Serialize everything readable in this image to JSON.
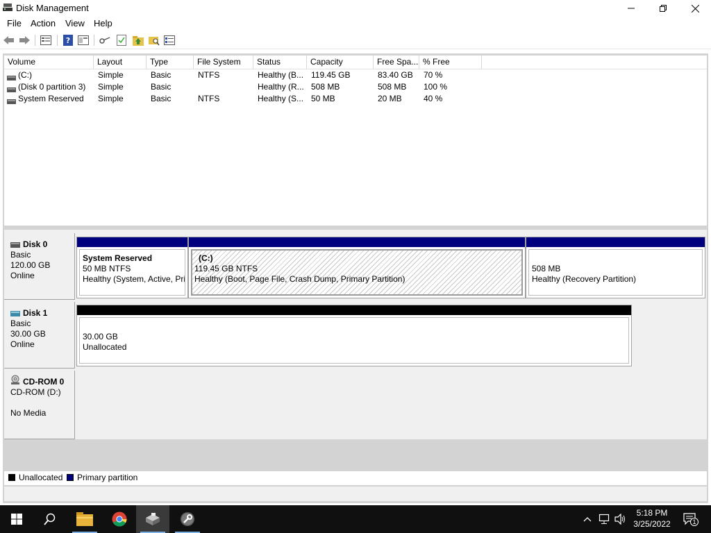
{
  "window": {
    "title": "Disk Management"
  },
  "menu": [
    "File",
    "Action",
    "View",
    "Help"
  ],
  "toolbar_icons": [
    "back-arrow-icon",
    "forward-arrow-icon",
    "list-view-icon",
    "help-icon",
    "properties-icon",
    "key-icon",
    "check-icon",
    "folder-up-icon",
    "search-folder-icon",
    "settings-list-icon"
  ],
  "volume_table": {
    "columns": [
      "Volume",
      "Layout",
      "Type",
      "File System",
      "Status",
      "Capacity",
      "Free Spa...",
      "% Free"
    ],
    "rows": [
      {
        "volume": "(C:)",
        "layout": "Simple",
        "type": "Basic",
        "fs": "NTFS",
        "status": "Healthy (B...",
        "capacity": "119.45 GB",
        "free": "83.40 GB",
        "pct": "70 %"
      },
      {
        "volume": "(Disk 0 partition 3)",
        "layout": "Simple",
        "type": "Basic",
        "fs": "",
        "status": "Healthy (R...",
        "capacity": "508 MB",
        "free": "508 MB",
        "pct": "100 %"
      },
      {
        "volume": "System Reserved",
        "layout": "Simple",
        "type": "Basic",
        "fs": "NTFS",
        "status": "Healthy (S...",
        "capacity": "50 MB",
        "free": "20 MB",
        "pct": "40 %"
      }
    ]
  },
  "disks": [
    {
      "name": "Disk 0",
      "kind": "Basic",
      "size": "120.00 GB",
      "state": "Online",
      "partitions": [
        {
          "title": "System Reserved",
          "size": "50 MB NTFS",
          "status": "Healthy (System, Active, Pri"
        },
        {
          "title": "(C:)",
          "size": "119.45 GB NTFS",
          "status": "Healthy (Boot, Page File, Crash Dump, Primary Partition)"
        },
        {
          "title": "",
          "size": "508 MB",
          "status": "Healthy (Recovery Partition)"
        }
      ]
    },
    {
      "name": "Disk 1",
      "kind": "Basic",
      "size": "30.00 GB",
      "state": "Online",
      "partitions": [
        {
          "size": "30.00 GB",
          "status": "Unallocated"
        }
      ]
    },
    {
      "name": "CD-ROM 0",
      "kind": "CD-ROM (D:)",
      "state": "No Media"
    }
  ],
  "legend": [
    {
      "label": "Unallocated",
      "color": "#000000"
    },
    {
      "label": "Primary partition",
      "color": "#00007f"
    }
  ],
  "colors": {
    "primary_bar": "#00007f",
    "unallocated_bar": "#000000",
    "taskbar": "#101010"
  },
  "taskbar": {
    "apps": [
      "start-icon",
      "search-icon",
      "file-explorer-icon",
      "chrome-icon",
      "disk-management-icon",
      "settings-tool-icon"
    ],
    "time": "5:18 PM",
    "date": "3/25/2022",
    "notification_count": "1"
  }
}
